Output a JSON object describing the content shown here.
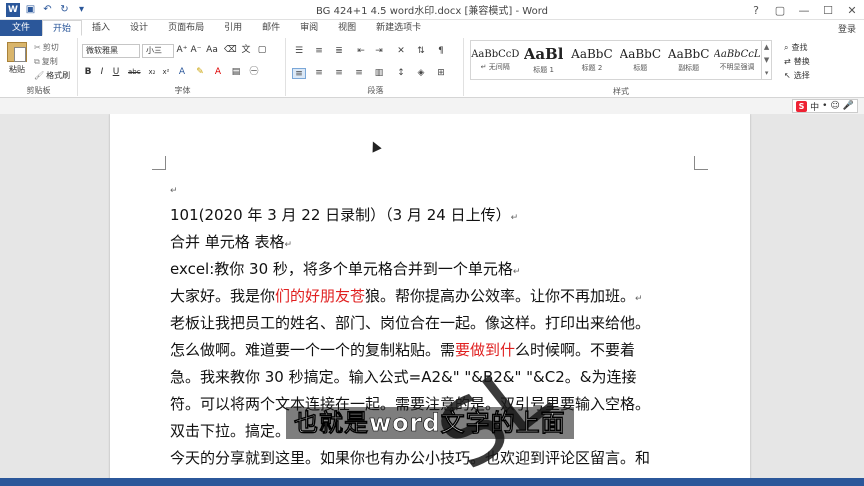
{
  "window": {
    "title": "BG 424+1 4.5 word水印.docx [兼容模式] - Word",
    "controls": [
      "?",
      "▢",
      "—",
      "☐",
      "✕"
    ]
  },
  "tabs": [
    "文件",
    "开始",
    "插入",
    "设计",
    "页面布局",
    "引用",
    "邮件",
    "审阅",
    "视图",
    "新建选项卡"
  ],
  "login": "登录",
  "ribbon": {
    "clipboard": {
      "paste": "粘贴",
      "cut": "剪切",
      "copy": "复制",
      "format_painter": "格式刷",
      "label": "剪贴板"
    },
    "font": {
      "name": "微软雅黑",
      "size": "小三",
      "label": "字体"
    },
    "paragraph": {
      "label": "段落"
    },
    "styles": {
      "label": "样式",
      "items": [
        {
          "sample": "AaBbCcD",
          "name": "↵ 无间隔"
        },
        {
          "sample": "AaBl",
          "name": "标题 1"
        },
        {
          "sample": "AaBbC",
          "name": "标题 2"
        },
        {
          "sample": "AaBbC",
          "name": "标题"
        },
        {
          "sample": "AaBbC",
          "name": "副标题"
        },
        {
          "sample": "AaBbCcL",
          "name": "不明显强调"
        }
      ]
    },
    "editing": {
      "find": "查找",
      "replace": "替换",
      "select": "选择"
    }
  },
  "ime": {
    "lang": "中"
  },
  "document": {
    "lines": [
      "101(2020 年 3 月 22 日录制）（3 月 24 日上传）",
      "合并 单元格 表格",
      "excel:教你 30 秒，将多个单元格合并到一个单元格"
    ],
    "p1_a": "大家好。我是你",
    "p1_red": "们的好朋友苍",
    "p1_b": "狼。帮你提高办公效率。让你不再加班。",
    "p2": "老板让我把员工的姓名、部门、岗位合在一起。像这样。打印出来给他。",
    "p3_a": "怎么做啊。难道要一个一个的复制粘贴。需",
    "p3_red": "要做到什",
    "p3_b": "么时候啊。不要着",
    "p4": "急。我来教你 30 秒搞定。输入公式=A2&\" \"&B2&\" \"&C2。&为连接",
    "p5": "符。可以将两个文本连接在一起。需要注意的是。双引号里要输入空格。",
    "p6": "双击下拉。搞定。",
    "p7": "今天的分享就到这里。如果你也有办公小技巧。也欢迎到评论区留言。和",
    "para_mark": "↵"
  },
  "watermark": "SL",
  "caption": "也就是word文字的上面"
}
